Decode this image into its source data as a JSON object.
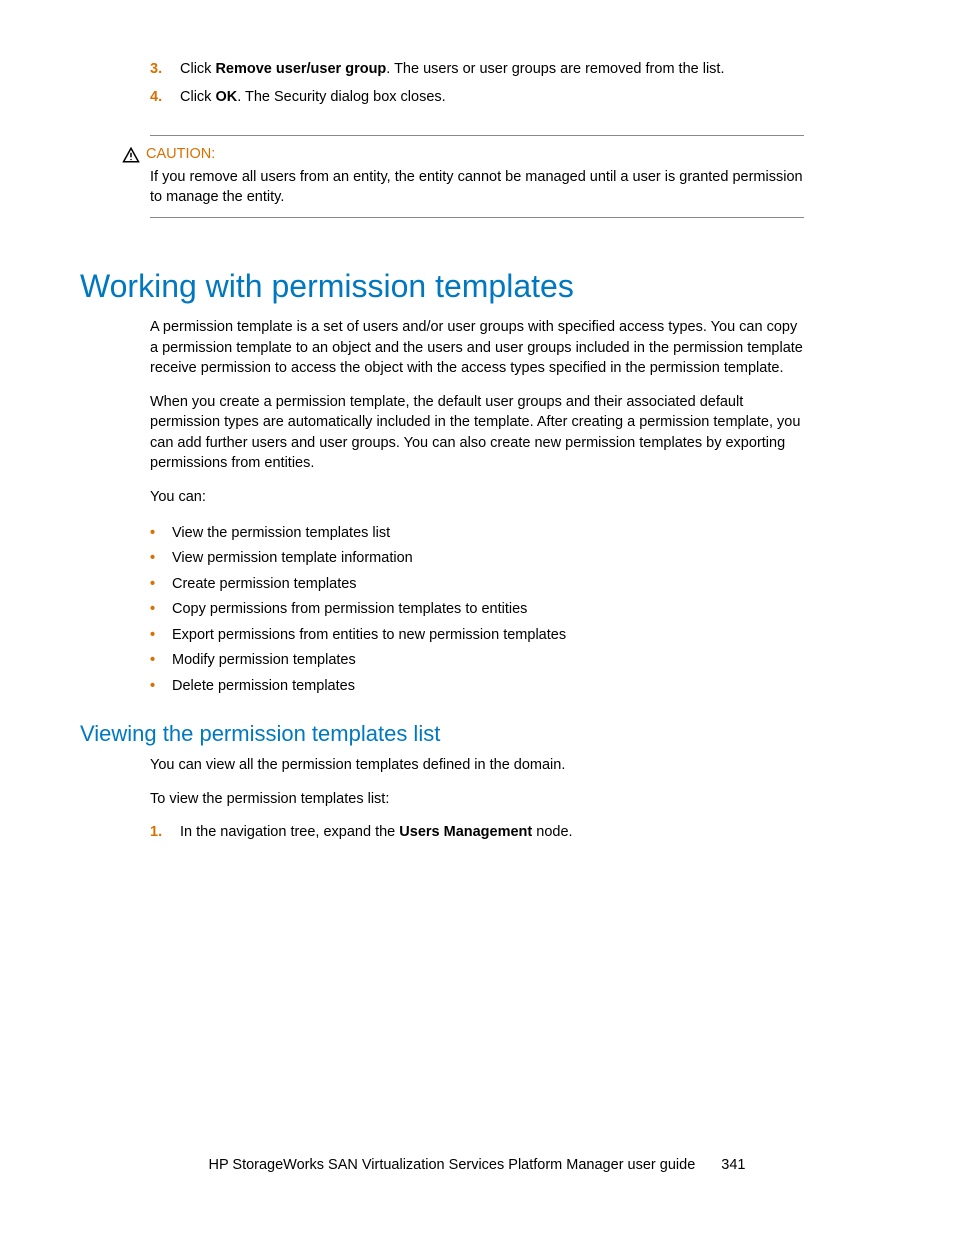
{
  "steps": {
    "s3": {
      "num": "3.",
      "pre": "Click ",
      "bold": "Remove user/user group",
      "post": ". The users or user groups are removed from the list."
    },
    "s4": {
      "num": "4.",
      "pre": "Click ",
      "bold": "OK",
      "post": ". The Security dialog box closes."
    }
  },
  "caution": {
    "label": "CAUTION:",
    "text": "If you remove all users from an entity, the entity cannot be managed until a user is granted permission to manage the entity."
  },
  "section1": {
    "title": "Working with permission templates",
    "para1": "A permission template is a set of users and/or user groups with specified access types. You can copy a permission template to an object and the users and user groups included in the permission template receive permission to access the object with the access types specified in the permission template.",
    "para2": "When you create a permission template, the default user groups and their associated default permission types are automatically included in the template. After creating a permission template, you can add further users and user groups. You can also create new permission templates by exporting permissions from entities.",
    "para3": "You can:",
    "bullets": [
      "View the permission templates list",
      "View permission template information",
      "Create permission templates",
      "Copy permissions from permission templates to entities",
      "Export permissions from entities to new permission templates",
      "Modify permission templates",
      "Delete permission templates"
    ]
  },
  "section2": {
    "title": "Viewing the permission templates list",
    "para1": "You can view all the permission templates defined in the domain.",
    "para2": "To view the permission templates list:",
    "step1": {
      "num": "1.",
      "pre": "In the navigation tree, expand the ",
      "bold": "Users Management",
      "post": " node."
    }
  },
  "footer": {
    "title": "HP StorageWorks SAN Virtualization Services Platform Manager user guide",
    "page": "341"
  }
}
